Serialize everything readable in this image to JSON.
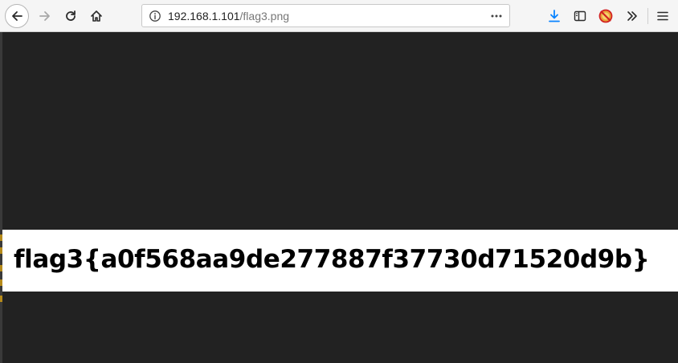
{
  "browser": {
    "url": {
      "host": "192.168.1.101",
      "path": "/flag3.png"
    },
    "icons": {
      "back": "arrow-left-icon",
      "forward": "arrow-right-icon",
      "reload": "reload-icon",
      "home": "home-icon",
      "site_info": "info-icon",
      "page_actions": "ellipsis-icon",
      "downloads": "download-icon",
      "sidebar": "sidebar-icon",
      "addon": "addon-icon",
      "overflow": "double-chevron-icon",
      "menu": "hamburger-icon"
    },
    "colors": {
      "accent": "#0a84ff",
      "page_background": "#222222"
    }
  },
  "content": {
    "image_text": "flag3{a0f568aa9de277887f37730d71520d9b}"
  }
}
